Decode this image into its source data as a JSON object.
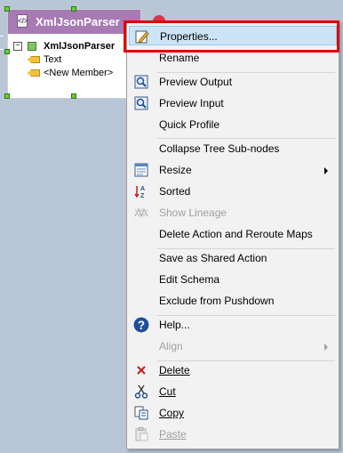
{
  "node": {
    "title": "XmlJsonParser",
    "icon": "xml-parser-icon",
    "tree": [
      {
        "label": "XmlJsonParser",
        "type": "root"
      },
      {
        "label": "Text",
        "type": "field"
      },
      {
        "label": "<New Member>",
        "type": "field"
      }
    ]
  },
  "menu": {
    "items": [
      {
        "label": "Properties...",
        "icon": "edit-pencil-icon"
      },
      {
        "label": "Rename"
      },
      {
        "label": "Preview Output",
        "icon": "preview-icon"
      },
      {
        "label": "Preview Input",
        "icon": "preview-icon"
      },
      {
        "label": "Quick Profile"
      },
      {
        "label": "Collapse Tree Sub-nodes"
      },
      {
        "label": "Resize",
        "icon": "resize-icon"
      },
      {
        "label": "Sorted",
        "icon": "sort-icon"
      },
      {
        "label": "Show Lineage",
        "icon": "lineage-icon",
        "disabled": true
      },
      {
        "label": "Delete Action and Reroute Maps"
      },
      {
        "label": "Save as Shared Action"
      },
      {
        "label": "Edit Schema"
      },
      {
        "label": "Exclude from Pushdown"
      },
      {
        "label": "Help...",
        "icon": "help-icon"
      },
      {
        "label": "Align",
        "disabled": true
      },
      {
        "label": "Delete",
        "icon": "delete-icon"
      },
      {
        "label": "Cut",
        "icon": "cut-icon"
      },
      {
        "label": "Copy",
        "icon": "copy-icon"
      },
      {
        "label": "Paste",
        "icon": "paste-icon",
        "disabled": true
      }
    ]
  },
  "colors": {
    "canvas_bg": "#b8c6d6",
    "node_header": "#a77ab4",
    "menu_bg": "#f2f2f2",
    "highlight": "#cce4f7",
    "annotation_outline": "#e00000"
  }
}
